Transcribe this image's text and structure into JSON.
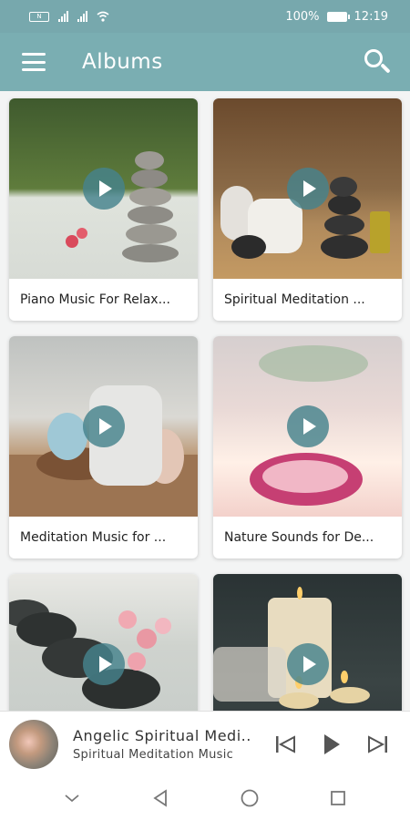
{
  "status_bar": {
    "left_icons": [
      "nfc-icon",
      "signal-icon",
      "signal-icon",
      "wifi-icon"
    ],
    "battery": "100%",
    "time": "12:19"
  },
  "header": {
    "title": "Albums",
    "menu_icon": "hamburger-icon",
    "search_icon": "search-icon",
    "bg": "#7aaeb2"
  },
  "albums": [
    {
      "label": "Piano Music For Relax..."
    },
    {
      "label": "Spiritual Meditation ..."
    },
    {
      "label": "Meditation Music for ..."
    },
    {
      "label": "Nature Sounds for De..."
    },
    {
      "label": ""
    },
    {
      "label": ""
    }
  ],
  "player": {
    "title": "Angelic Spiritual Medi..",
    "subtitle": "Spiritual Meditation Music",
    "controls": [
      "skip-previous-icon",
      "play-icon",
      "skip-next-icon"
    ]
  },
  "system_nav": [
    "chevron-down-icon",
    "back-icon",
    "home-icon",
    "recents-icon"
  ]
}
